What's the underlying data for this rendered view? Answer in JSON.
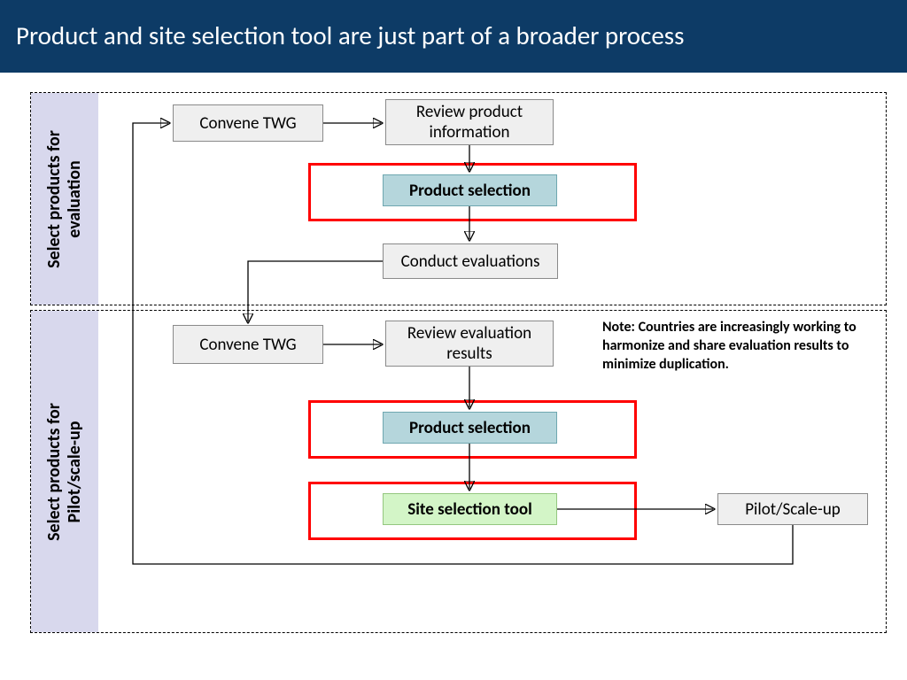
{
  "header": {
    "title": "Product and site selection tool are just part of a broader process"
  },
  "phase1": {
    "label": "Select products for\nevaluation",
    "boxes": {
      "convene": "Convene TWG",
      "review": "Review product information",
      "product_selection": "Product selection",
      "conduct": "Conduct evaluations"
    }
  },
  "phase2": {
    "label": "Select products for\nPilot/scale-up",
    "boxes": {
      "convene": "Convene TWG",
      "review": "Review evaluation results",
      "product_selection": "Product selection",
      "site_selection": "Site selection tool",
      "pilot": "Pilot/Scale-up"
    },
    "note": "Note: Countries are increasingly working to harmonize and share evaluation results to minimize duplication."
  }
}
